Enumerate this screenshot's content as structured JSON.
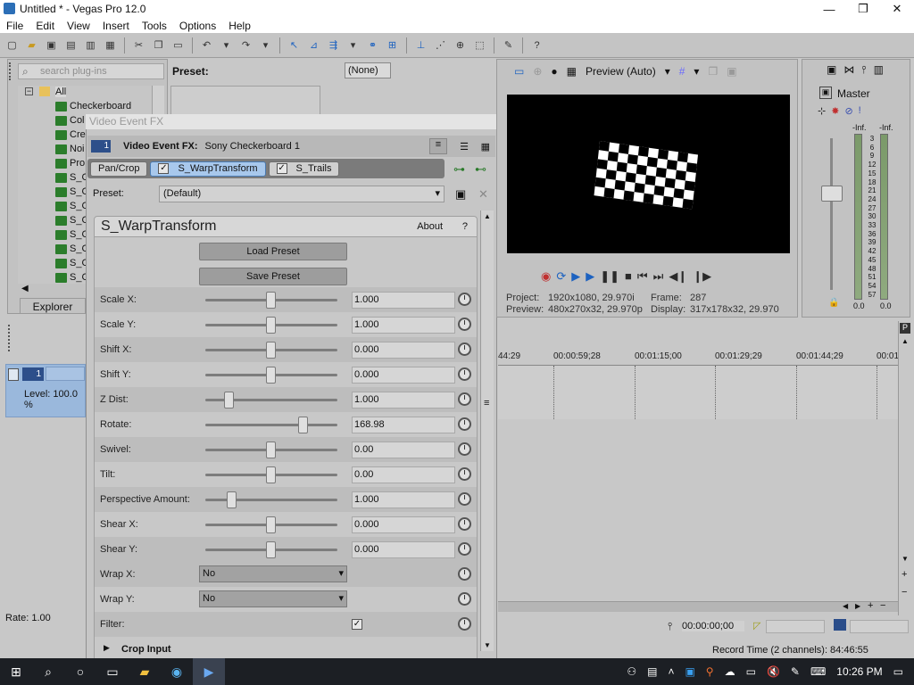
{
  "window": {
    "title": "Untitled * - Vegas Pro 12.0",
    "min": "—",
    "max": "❐",
    "close": "✕"
  },
  "menu": [
    "File",
    "Edit",
    "View",
    "Insert",
    "Tools",
    "Options",
    "Help"
  ],
  "plugins": {
    "search_placeholder": "search plug-ins",
    "preset_label": "Preset:",
    "root": "All",
    "items": [
      "Checkerboard",
      "Col",
      "Cre",
      "Noi",
      "Pro",
      "S_C",
      "S_C",
      "S_C",
      "S_C",
      "S_C",
      "S_C",
      "S_C",
      "S_C"
    ],
    "tab": "Explorer",
    "selector": "(None)"
  },
  "fx": {
    "window_title": "Video Event FX",
    "badge": "1",
    "header_label": "Video Event FX:",
    "header_value": "Sony Checkerboard 1",
    "chain": [
      {
        "label": "Pan/Crop",
        "checked": false,
        "active": false
      },
      {
        "label": "S_WarpTransform",
        "checked": true,
        "active": true
      },
      {
        "label": "S_Trails",
        "checked": true,
        "active": false
      }
    ],
    "preset_label": "Preset:",
    "preset_value": "(Default)",
    "plugin_name": "S_WarpTransform",
    "about": "About",
    "help": "?",
    "load_preset": "Load Preset",
    "save_preset": "Save Preset",
    "params": [
      {
        "label": "Scale X:",
        "value": "1.000",
        "level": 0.5
      },
      {
        "label": "Scale Y:",
        "value": "1.000",
        "level": 0.5
      },
      {
        "label": "Shift X:",
        "value": "0.000",
        "level": 0.5
      },
      {
        "label": "Shift Y:",
        "value": "0.000",
        "level": 0.5
      },
      {
        "label": "Z Dist:",
        "value": "1.000",
        "level": 0.18
      },
      {
        "label": "Rotate:",
        "value": "168.98",
        "level": 0.74
      },
      {
        "label": "Swivel:",
        "value": "0.00",
        "level": 0.5
      },
      {
        "label": "Tilt:",
        "value": "0.00",
        "level": 0.5
      },
      {
        "label": "Perspective Amount:",
        "value": "1.000",
        "level": 0.2
      },
      {
        "label": "Shear X:",
        "value": "0.000",
        "level": 0.5
      },
      {
        "label": "Shear Y:",
        "value": "0.000",
        "level": 0.5
      }
    ],
    "wrap_x_label": "Wrap X:",
    "wrap_x_value": "No",
    "wrap_y_label": "Wrap Y:",
    "wrap_y_value": "No",
    "filter_label": "Filter:",
    "filter_checked": true,
    "crop_input": "Crop Input"
  },
  "preview": {
    "mode": "Preview (Auto)",
    "project_label": "Project:",
    "project_value": "1920x1080, 29.970i",
    "frame_label": "Frame:",
    "frame_value": "287",
    "preview_label": "Preview:",
    "preview_value": "480x270x32, 29.970p",
    "display_label": "Display:",
    "display_value": "317x178x32, 29.970"
  },
  "master": {
    "label": "Master",
    "inf_l": "-Inf.",
    "inf_r": "-Inf.",
    "scale": [
      "3",
      "6",
      "9",
      "12",
      "15",
      "18",
      "21",
      "24",
      "27",
      "30",
      "33",
      "36",
      "39",
      "42",
      "45",
      "48",
      "51",
      "54",
      "57"
    ],
    "bottom_l": "0.0",
    "bottom_r": "0.0"
  },
  "track": {
    "number": "1",
    "level": "Level: 100.0 %"
  },
  "rate": "Rate: 1.00",
  "timeline": {
    "ruler": [
      "44:29",
      "00:00:59;28",
      "00:01:15;00",
      "00:01:29;29",
      "00:01:44;29",
      "00:01"
    ],
    "timecode": "00:00:00;00",
    "record_time": "Record Time (2 channels): 84:46:55"
  },
  "taskbar": {
    "time": "10:26 PM"
  }
}
